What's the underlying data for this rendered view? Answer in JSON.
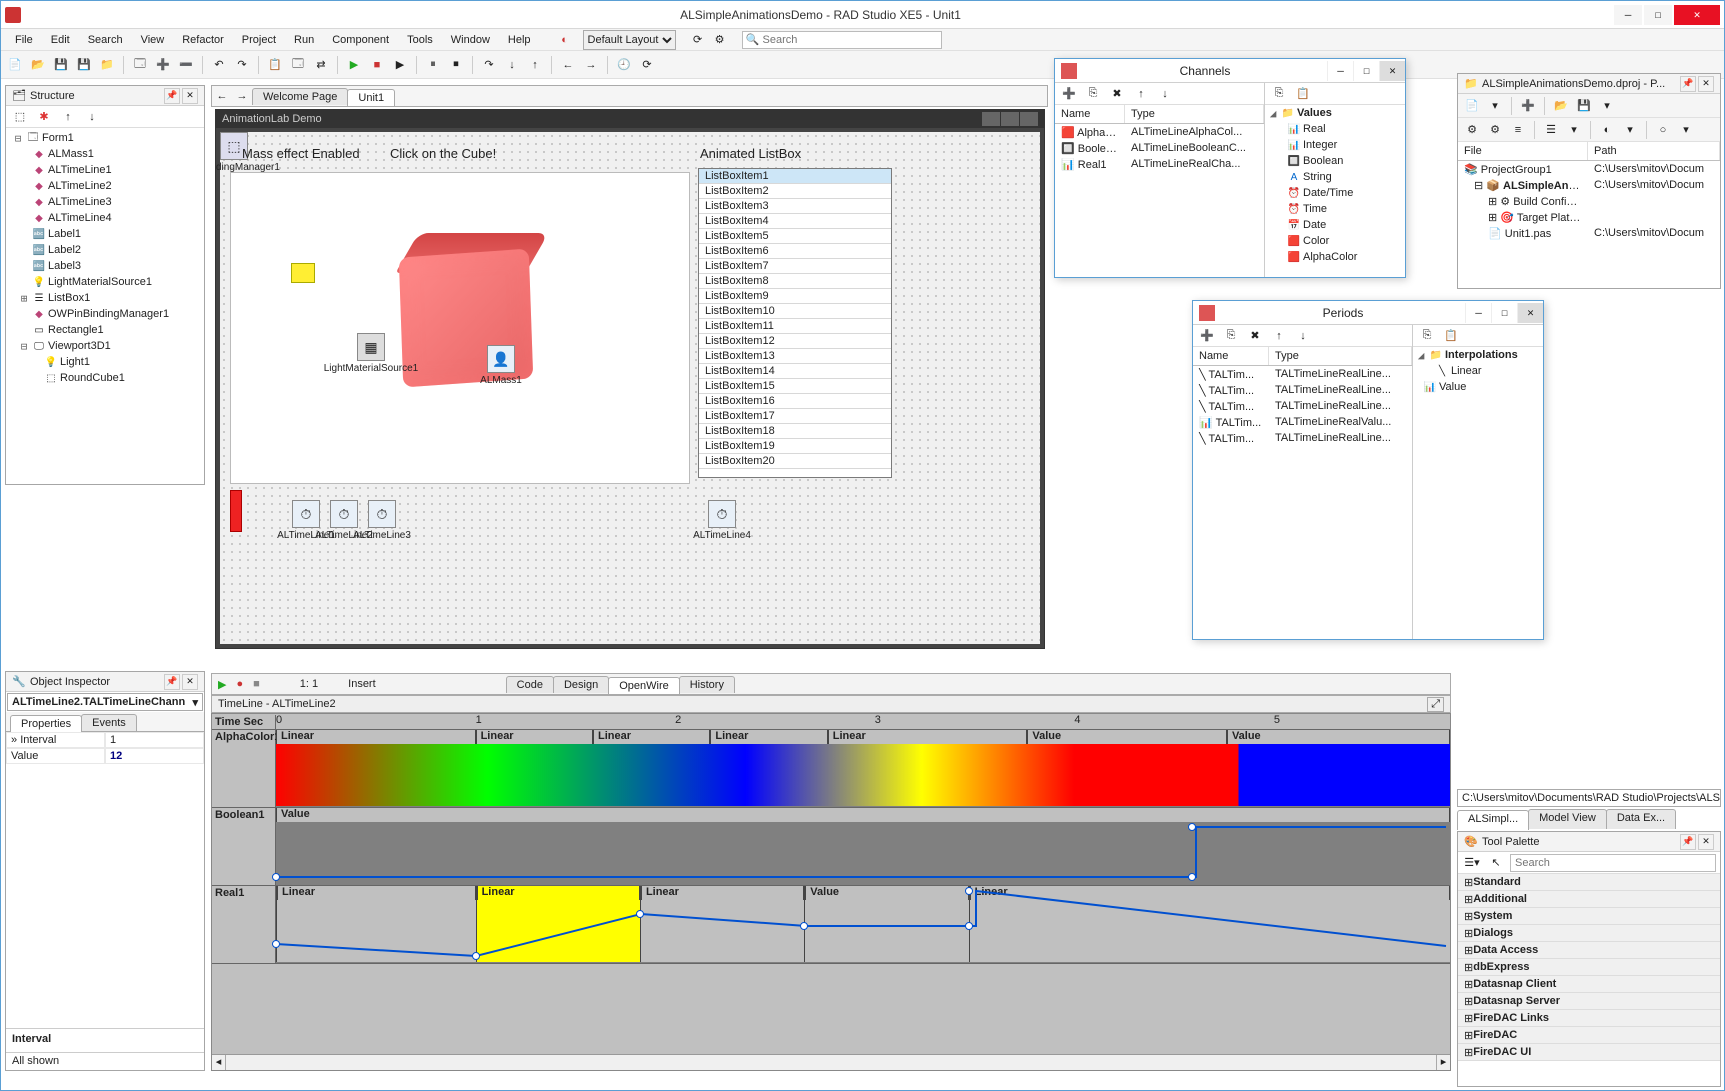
{
  "window": {
    "title": "ALSimpleAnimationsDemo - RAD Studio XE5 - Unit1"
  },
  "menu": [
    "File",
    "Edit",
    "Search",
    "View",
    "Refactor",
    "Project",
    "Run",
    "Component",
    "Tools",
    "Window",
    "Help"
  ],
  "layout_selector": "Default Layout",
  "search_placeholder": "Search",
  "structure": {
    "title": "Structure",
    "root": "Form1",
    "items": [
      "ALMass1",
      "ALTimeLine1",
      "ALTimeLine2",
      "ALTimeLine3",
      "ALTimeLine4",
      "Label1",
      "Label2",
      "Label3",
      "LightMaterialSource1",
      "ListBox1",
      "OWPinBindingManager1",
      "Rectangle1",
      "Viewport3D1"
    ],
    "viewport_children": [
      "Light1",
      "RoundCube1"
    ]
  },
  "editor_tabs": [
    "Welcome Page",
    "Unit1"
  ],
  "designer": {
    "title": "AnimationLab Demo",
    "label_bindmgr": "dingManager1",
    "label_mass": "Mass effect Enabled",
    "label_click": "Click on the Cube!",
    "label_listbox": "Animated ListBox",
    "light_label": "LightMaterialSource1",
    "mass_label": "ALMass1",
    "tl1": "ALTimeLine1",
    "tl2": "ALTimeLine2",
    "tl3": "ALTimeLine3",
    "tl4": "ALTimeLine4",
    "listitems": [
      "ListBoxItem1",
      "ListBoxItem2",
      "ListBoxItem3",
      "ListBoxItem4",
      "ListBoxItem5",
      "ListBoxItem6",
      "ListBoxItem7",
      "ListBoxItem8",
      "ListBoxItem9",
      "ListBoxItem10",
      "ListBoxItem11",
      "ListBoxItem12",
      "ListBoxItem13",
      "ListBoxItem14",
      "ListBoxItem15",
      "ListBoxItem16",
      "ListBoxItem17",
      "ListBoxItem18",
      "ListBoxItem19",
      "ListBoxItem20"
    ]
  },
  "bottom_tabs": [
    "Code",
    "Design",
    "OpenWire",
    "History"
  ],
  "object_inspector": {
    "title": "Object Inspector",
    "target": "ALTimeLine2.TALTimeLineChann",
    "tabs": [
      "Properties",
      "Events"
    ],
    "props": [
      {
        "name": "Interval",
        "value": "1"
      },
      {
        "name": "Value",
        "value": "12"
      }
    ],
    "footer_label": "Interval",
    "all_shown": "All shown"
  },
  "timeline": {
    "rec": "●",
    "stop": "■",
    "pos": "1: 1",
    "mode": "Insert",
    "title": "TimeLine - ALTimeLine2",
    "ruler_label": "Time Sec",
    "ticks": [
      "0",
      "1",
      "2",
      "3",
      "4",
      "5"
    ],
    "tracks": {
      "alpha": {
        "name": "AlphaColor1",
        "segs": [
          "Linear",
          "Linear",
          "Linear",
          "Linear",
          "Linear",
          "Value",
          "Value"
        ]
      },
      "bool": {
        "name": "Boolean1",
        "segs": [
          "Value"
        ]
      },
      "real": {
        "name": "Real1",
        "segs": [
          "Linear",
          "Linear",
          "Linear",
          "Value",
          "Linear"
        ]
      }
    }
  },
  "channels_dialog": {
    "title": "Channels",
    "col_name": "Name",
    "col_type": "Type",
    "rows": [
      {
        "name": "AlphaC...",
        "type": "ALTimeLineAlphaCol..."
      },
      {
        "name": "Boolean1",
        "type": "ALTimeLineBooleanC..."
      },
      {
        "name": "Real1",
        "type": "ALTimeLineRealCha..."
      }
    ],
    "values_hdr": "Values",
    "values": [
      "Real",
      "Integer",
      "Boolean",
      "String",
      "Date/Time",
      "Time",
      "Date",
      "Color",
      "AlphaColor"
    ]
  },
  "periods_dialog": {
    "title": "Periods",
    "col_name": "Name",
    "col_type": "Type",
    "rows": [
      {
        "name": "TALTim...",
        "type": "TALTimeLineRealLine..."
      },
      {
        "name": "TALTim...",
        "type": "TALTimeLineRealLine..."
      },
      {
        "name": "TALTim...",
        "type": "TALTimeLineRealLine..."
      },
      {
        "name": "TALTim...",
        "type": "TALTimeLineRealValu..."
      },
      {
        "name": "TALTim...",
        "type": "TALTimeLineRealLine..."
      }
    ],
    "right_hdr": "Interpolations",
    "right_items": [
      "Linear",
      "Value"
    ]
  },
  "project_manager": {
    "title": "ALSimpleAnimationsDemo.dproj - P...",
    "col_file": "File",
    "col_path": "Path",
    "rows": [
      {
        "file": "ProjectGroup1",
        "path": "C:\\Users\\mitov\\Docum"
      },
      {
        "file": "ALSimpleAnim...",
        "path": "C:\\Users\\mitov\\Docum"
      },
      {
        "file": "Build Configur...",
        "path": ""
      },
      {
        "file": "Target Platfo...",
        "path": ""
      },
      {
        "file": "Unit1.pas",
        "path": "C:\\Users\\mitov\\Docum"
      }
    ]
  },
  "path_bar": "C:\\Users\\mitov\\Documents\\RAD Studio\\Projects\\ALS",
  "pm_tabs": [
    "ALSimpl...",
    "Model View",
    "Data Ex..."
  ],
  "tool_palette": {
    "title": "Tool Palette",
    "search_placeholder": "Search",
    "groups": [
      "Standard",
      "Additional",
      "System",
      "Dialogs",
      "Data Access",
      "dbExpress",
      "Datasnap Client",
      "Datasnap Server",
      "FireDAC Links",
      "FireDAC",
      "FireDAC UI"
    ]
  }
}
